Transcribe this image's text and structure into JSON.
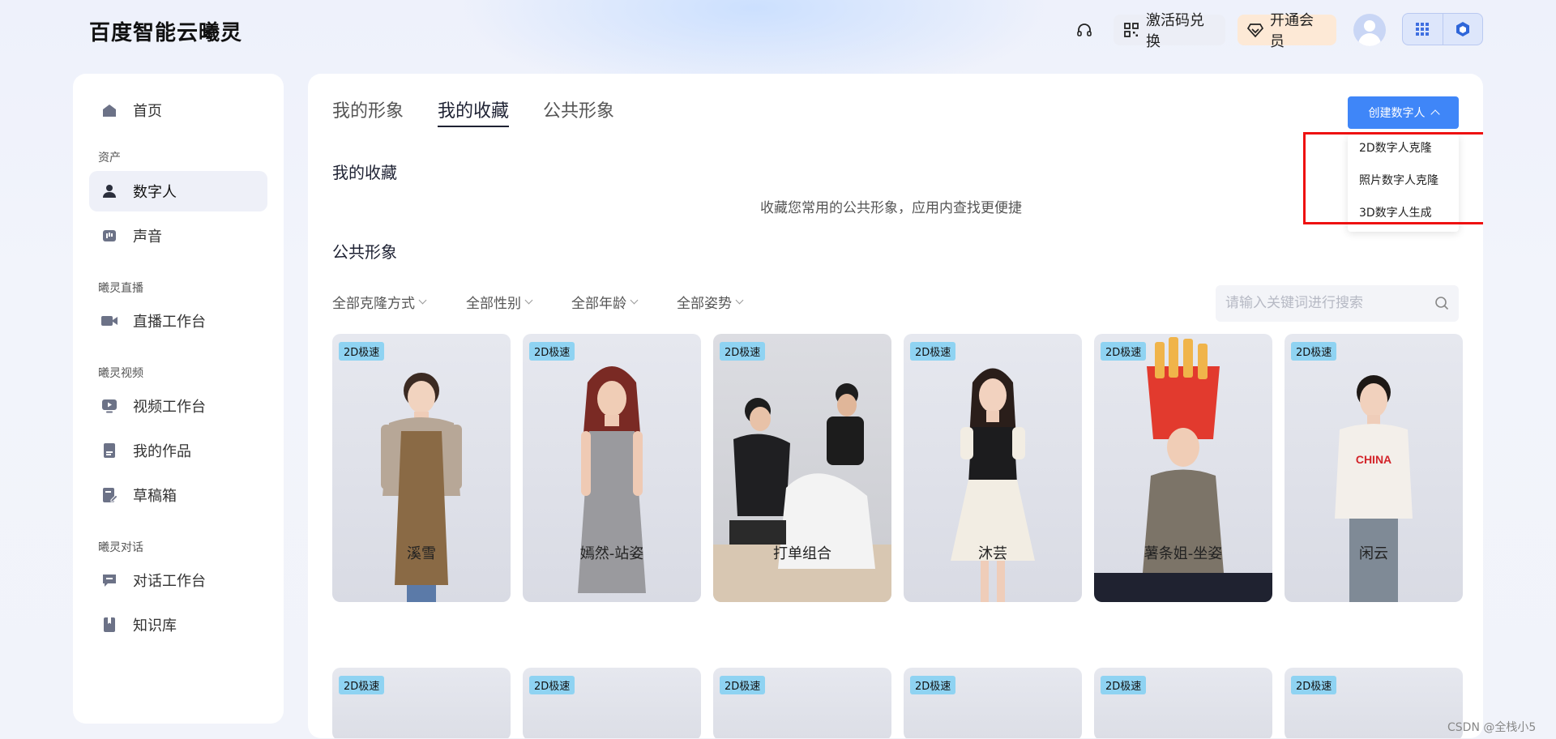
{
  "header": {
    "logo": "百度智能云曦灵",
    "redeem_label": "激活码兑换",
    "vip_label": "开通会员"
  },
  "sidebar": {
    "home": "首页",
    "groups": {
      "assets": "资产",
      "live": "曦灵直播",
      "video": "曦灵视频",
      "chat": "曦灵对话"
    },
    "items": {
      "digital_human": "数字人",
      "voice": "声音",
      "live_workbench": "直播工作台",
      "video_workbench": "视频工作台",
      "my_works": "我的作品",
      "drafts": "草稿箱",
      "chat_workbench": "对话工作台",
      "knowledge_base": "知识库"
    }
  },
  "main": {
    "tabs": [
      "我的形象",
      "我的收藏",
      "公共形象"
    ],
    "active_tab": "我的收藏",
    "create_button": "创建数字人",
    "dropdown": [
      "2D数字人克隆",
      "照片数字人克隆",
      "3D数字人生成"
    ],
    "favorites_title": "我的收藏",
    "favorites_empty": "收藏您常用的公共形象，应用内查找更便捷",
    "public_title": "公共形象",
    "filters": [
      "全部克隆方式",
      "全部性别",
      "全部年龄",
      "全部姿势"
    ],
    "search_placeholder": "请输入关键词进行搜索",
    "cards": [
      {
        "tag": "2D极速",
        "name": "溪雪"
      },
      {
        "tag": "2D极速",
        "name": "嫣然-站姿"
      },
      {
        "tag": "2D极速",
        "name": "打单组合"
      },
      {
        "tag": "2D极速",
        "name": "沐芸"
      },
      {
        "tag": "2D极速",
        "name": "薯条姐-坐姿"
      },
      {
        "tag": "2D极速",
        "name": "闲云"
      }
    ],
    "cards_row2_tag": "2D极速",
    "china_text": "CHINA"
  },
  "watermark": "CSDN @全栈小5",
  "colors": {
    "accent": "#3f86f8",
    "highlight": "#e11111",
    "tag": "#8fd3f2"
  }
}
